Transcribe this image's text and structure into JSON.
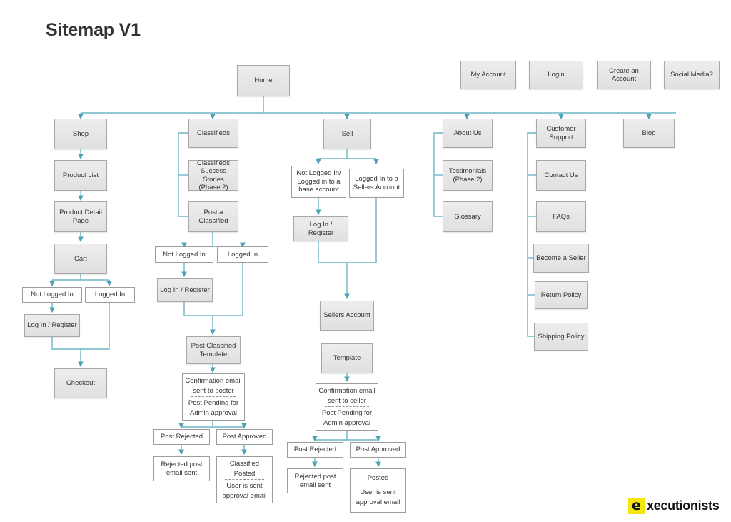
{
  "page": {
    "title": "Sitemap V1",
    "accent_line_color": "#4ea3b5",
    "node_fill": "#e8e8e8",
    "node_border": "#a8a8a8",
    "text_color": "#333333"
  },
  "logo": {
    "mark": "e",
    "word": "xecutionists",
    "mark_bg": "#f5e60c"
  },
  "nodes": {
    "home": "Home",
    "my_account": "My Account",
    "login": "Login",
    "create_account_l1": "Create an",
    "create_account_l2": "Account",
    "social_media": "Social Media?",
    "shop": "Shop",
    "product_list": "Product List",
    "product_detail_l1": "Product Detail",
    "product_detail_l2": "Page",
    "cart": "Cart",
    "shop_not_logged_in": "Not Logged In",
    "shop_logged_in": "Logged In",
    "shop_login_register": "Log In / Register",
    "checkout": "Checkout",
    "classifieds": "Classifieds",
    "classifieds_success_l1": "Classifieds",
    "classifieds_success_l2": "Success Stories",
    "classifieds_success_l3": "(Phase 2)",
    "post_classified_l1": "Post a",
    "post_classified_l2": "Classified",
    "cls_not_logged_in": "Not Logged In",
    "cls_logged_in": "Logged In",
    "cls_login_register": "Log In / Register",
    "post_classified_template_l1": "Post Classified",
    "post_classified_template_l2": "Template",
    "cls_confirm_l1": "Confirmation email",
    "cls_confirm_l2": "sent to poster",
    "cls_pending_l1": "Post Pending for",
    "cls_pending_l2": "Admin approval",
    "cls_post_rejected": "Post Rejected",
    "cls_post_approved": "Post Approved",
    "cls_rejected_email_l1": "Rejected post",
    "cls_rejected_email_l2": "email sent",
    "cls_posted_l1": "Classified",
    "cls_posted_l2": "Posted",
    "cls_posted_note_l1": "User is sent",
    "cls_posted_note_l2": "approval email",
    "sell": "Sell",
    "sell_not_logged_l1": "Not Logged In/",
    "sell_not_logged_l2": "Logged in to a",
    "sell_not_logged_l3": "base account",
    "sell_logged_l1": "Logged In to a",
    "sell_logged_l2": "Sellers Account",
    "sell_login_register": "Log In / Register",
    "sellers_account": "Sellers Account",
    "sell_template": "Template",
    "sell_confirm_l1": "Confirmation email",
    "sell_confirm_l2": "sent to seller",
    "sell_pending_l1": "Post Pending for",
    "sell_pending_l2": "Admin approval",
    "sell_post_rejected": "Post Rejected",
    "sell_post_approved": "Post Approved",
    "sell_rejected_email_l1": "Rejected post",
    "sell_rejected_email_l2": "email sent",
    "sell_posted": "Posted",
    "sell_posted_note_l1": "User is sent",
    "sell_posted_note_l2": "approval email",
    "about_us": "About Us",
    "testimonials_l1": "Testimonials",
    "testimonials_l2": "(Phase 2)",
    "glossary": "Glossary",
    "customer_support_l1": "Customer",
    "customer_support_l2": "Support",
    "contact_us": "Contact Us",
    "faqs": "FAQs",
    "become_a_seller": "Become a Seller",
    "return_policy": "Return Policy",
    "shipping_policy": "Shipping Policy",
    "blog": "Blog"
  }
}
